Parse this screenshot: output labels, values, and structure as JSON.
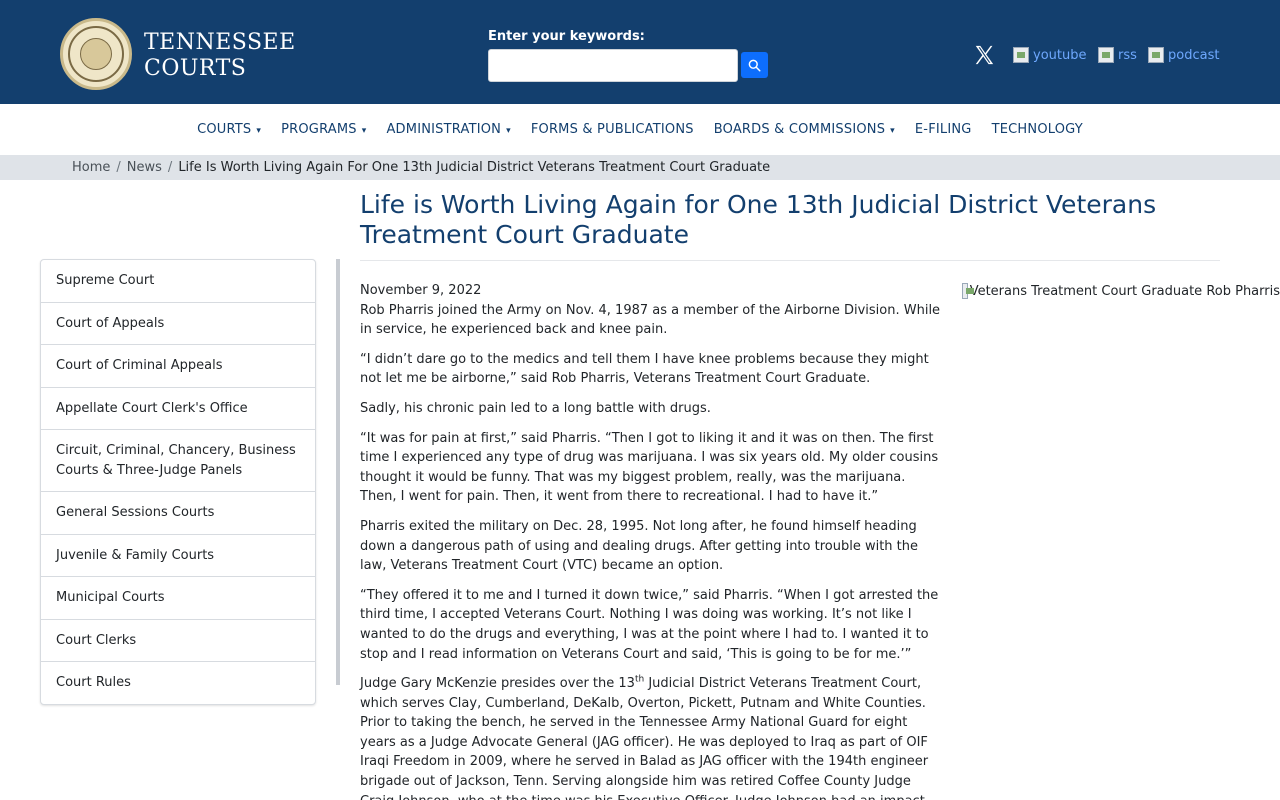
{
  "header": {
    "seal_alt": "SEAL OF THE TENNESSEE JUDICIARY",
    "logo_line1": "TENNESSEE",
    "logo_line2": "COURTS",
    "search_label": "Enter your keywords:",
    "search_value": "",
    "social": [
      {
        "icon": "x-logo-icon",
        "label": ""
      },
      {
        "icon": "youtube-icon",
        "label": "youtube"
      },
      {
        "icon": "rss-icon",
        "label": "rss"
      },
      {
        "icon": "podcast-icon",
        "label": "podcast"
      }
    ]
  },
  "nav": {
    "items": [
      {
        "label": "COURTS",
        "dropdown": true
      },
      {
        "label": "PROGRAMS",
        "dropdown": true
      },
      {
        "label": "ADMINISTRATION",
        "dropdown": true
      },
      {
        "label": "FORMS & PUBLICATIONS",
        "dropdown": false
      },
      {
        "label": "BOARDS & COMMISSIONS",
        "dropdown": true
      },
      {
        "label": "E-FILING",
        "dropdown": false
      },
      {
        "label": "TECHNOLOGY",
        "dropdown": false
      }
    ]
  },
  "breadcrumb": {
    "home": "Home",
    "news": "News",
    "current": "Life Is Worth Living Again For One 13th Judicial District Veterans Treatment Court Graduate"
  },
  "page": {
    "title": "Life is Worth Living Again for One 13th Judicial District Veterans Treatment Court Graduate"
  },
  "sidebar": {
    "items": [
      "Supreme Court",
      "Court of Appeals",
      "Court of Criminal Appeals",
      "Appellate Court Clerk's Office",
      "Circuit, Criminal, Chancery, Business Courts & Three-Judge Panels",
      "General Sessions Courts",
      "Juvenile & Family Courts",
      "Municipal Courts",
      "Court Clerks",
      "Court Rules"
    ]
  },
  "article": {
    "date": "November 9, 2022",
    "image_alt": "Veterans Treatment Court Graduate Rob Pharris",
    "p1": "Rob Pharris joined the Army on Nov. 4, 1987 as a member of the Airborne Division. While in service, he experienced back and knee pain.",
    "p2": "“I didn’t dare go to the medics and tell them I have knee problems because they might not let me be airborne,” said Rob Pharris, Veterans Treatment Court Graduate.",
    "p3": "Sadly, his chronic pain led to a long battle with drugs.",
    "p4": "“It was for pain at first,” said Pharris. “Then I got to liking it and it was on then. The first time I experienced any type of drug was marijuana. I was six years old. My older cousins thought it would be funny. That was my biggest problem, really, was the marijuana. Then, I went for pain. Then, it went from there to recreational. I had to have it.”",
    "p5": "Pharris exited the military on Dec. 28, 1995. Not long after, he found himself heading down a dangerous path of using and dealing drugs. After getting into trouble with the law, Veterans Treatment Court (VTC) became an option.",
    "p6": "“They offered it to me and I turned it down twice,” said Pharris. “When I got arrested the third time, I accepted Veterans Court. Nothing I was doing was working. It’s not like I wanted to do the drugs and everything, I was at the point where I had to. I wanted it to stop and I read information on Veterans Court and said, ‘This is going to be for me.’”",
    "p7_a": "Judge Gary McKenzie presides over the 13",
    "p7_sup": "th",
    "p7_b": " Judicial District Veterans Treatment Court, which serves Clay, Cumberland, DeKalb, Overton, Pickett, Putnam and White Counties. Prior to taking the bench, he served in the Tennessee Army National Guard for eight years as a Judge Advocate General (JAG officer). He was deployed to Iraq as part of OIF Iraqi Freedom in 2009, where he served in Balad as JAG officer with the 194th engineer brigade out of Jackson, Tenn. Serving alongside him was retired Coffee County Judge Craig Johnson, who at the time was his Executive Officer. Judge Johnson had an impact"
  }
}
